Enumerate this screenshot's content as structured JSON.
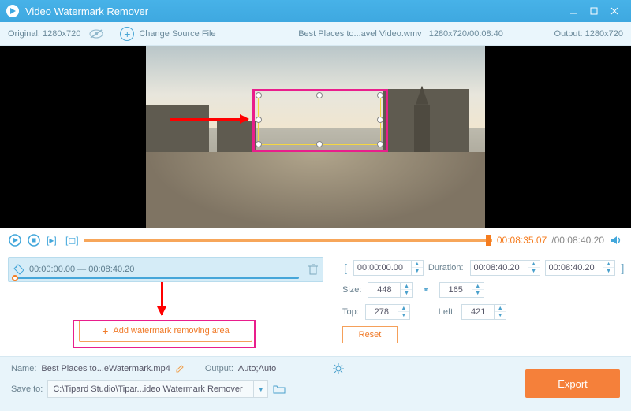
{
  "app": {
    "title": "Video Watermark Remover"
  },
  "toolbar": {
    "original_label": "Original:",
    "original_res": "1280x720",
    "change_source": "Change Source File",
    "filename": "Best Places to...avel Video.wmv",
    "file_res_time": "1280x720/00:08:40",
    "output_label": "Output:",
    "output_res": "1280x720"
  },
  "playback": {
    "current": "00:08:35.07",
    "total": "/00:08:40.20"
  },
  "clip": {
    "start": "00:00:00.00",
    "sep": " — ",
    "end": "00:08:40.20"
  },
  "add_area_label": "Add watermark removing area",
  "region": {
    "bracket_open": "[",
    "bracket_close": "]",
    "start_time": "00:00:00.00",
    "duration_label": "Duration:",
    "duration_value": "00:08:40.20",
    "end_time": "00:08:40.20",
    "size_label": "Size:",
    "width": "448",
    "height": "165",
    "top_label": "Top:",
    "top": "278",
    "left_label": "Left:",
    "left": "421",
    "reset": "Reset"
  },
  "footer": {
    "name_label": "Name:",
    "name_value": "Best Places to...eWatermark.mp4",
    "output_label": "Output:",
    "output_value": "Auto;Auto",
    "saveto_label": "Save to:",
    "saveto_value": "C:\\Tipard Studio\\Tipar...ideo Watermark Remover",
    "export": "Export"
  }
}
